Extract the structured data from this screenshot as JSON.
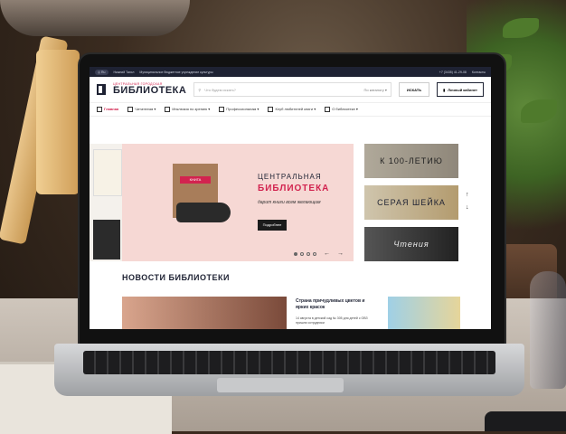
{
  "site": {
    "topbar": {
      "lang": "◎ Ru",
      "link1": "Нижний Тагил",
      "org": "Муниципальное бюджетное учреждение культуры",
      "phone": "+7 (3435) 41-29-08",
      "social": "Контакты"
    },
    "logo": {
      "small": "ЦЕНТРАЛЬНАЯ ГОРОДСКАЯ",
      "big": "БИБЛИОТЕКА"
    },
    "search": {
      "placeholder": "Что будем искать?",
      "select": "По каталогу ▾",
      "button": "ИСКАТЬ"
    },
    "cabinet_label": "Личный кабинет",
    "nav": [
      {
        "label": "Главная"
      },
      {
        "label": "Читателям ▾"
      },
      {
        "label": "Инклюзия по зрению ▾"
      },
      {
        "label": "Профессионалам ▾"
      },
      {
        "label": "Клуб любителей книги ▾"
      },
      {
        "label": "О библиотеке ▾"
      }
    ],
    "hero": {
      "book_tag": "КНИГА",
      "subtitle": "ЦЕНТРАЛЬНАЯ",
      "title": "БИБЛИОТЕКА",
      "text": "дарит книги всем желающим",
      "button": "Подробнее"
    },
    "side_banners": [
      "К 100-ЛЕТИЮ",
      "СЕРАЯ ШЕЙКА",
      "Чтения"
    ],
    "news": {
      "heading": "НОВОСТИ БИБЛИОТЕКИ",
      "item_title": "Страна причудливых цветов и ярких красок",
      "item_text": "14 августа в детский сад № 305 для детей с ОВЗ пришли сотрудники"
    }
  }
}
